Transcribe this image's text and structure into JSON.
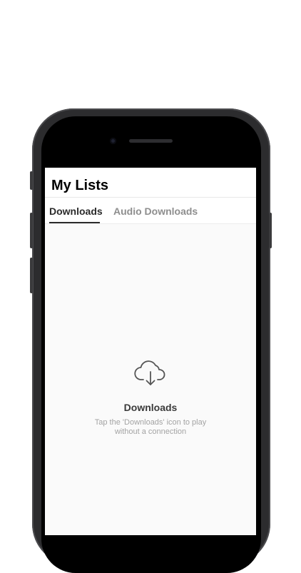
{
  "header": {
    "title": "My Lists"
  },
  "tabs": [
    {
      "label": "Downloads",
      "active": true
    },
    {
      "label": "Audio Downloads",
      "active": false
    }
  ],
  "empty_state": {
    "icon": "cloud-download-icon",
    "title": "Downloads",
    "description": "Tap the 'Downloads' icon to play without a connection"
  },
  "colors": {
    "active_tab": "#2b2b2b",
    "inactive_tab": "#8e8e8e",
    "background": "#fafafa"
  }
}
